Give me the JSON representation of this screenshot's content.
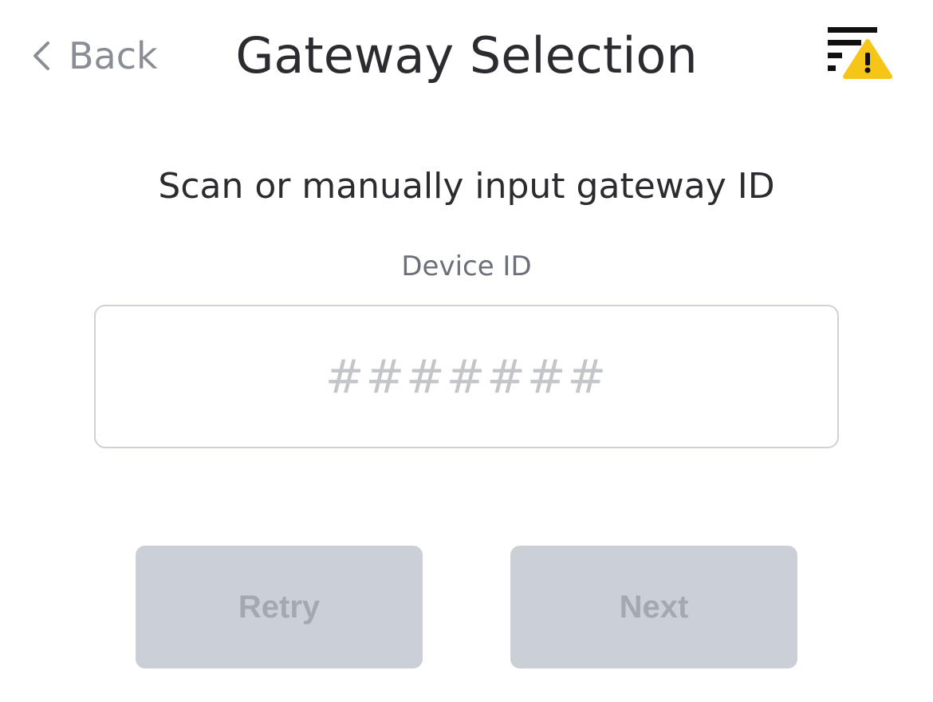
{
  "header": {
    "back_label": "Back",
    "title": "Gateway Selection",
    "back_icon": "chevron-left-icon",
    "action_icon": "filter-warning-icon"
  },
  "content": {
    "instruction": "Scan or manually input gateway ID",
    "field_label": "Device ID",
    "device_id_value": "",
    "device_id_placeholder": "#######"
  },
  "actions": {
    "retry_label": "Retry",
    "next_label": "Next"
  },
  "colors": {
    "title_text": "#2b2c30",
    "muted_text": "#8a8d93",
    "button_disabled_bg": "#cbcfd6",
    "button_disabled_text": "#a4a8b0",
    "warning_accent": "#f5c518"
  }
}
